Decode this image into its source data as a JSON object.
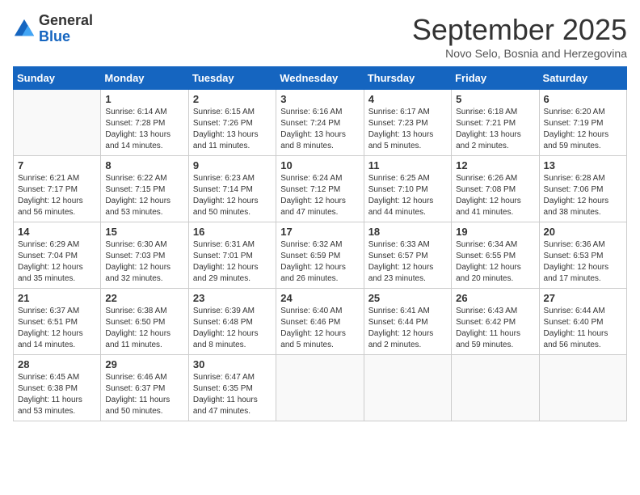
{
  "header": {
    "logo_line1": "General",
    "logo_line2": "Blue",
    "month_title": "September 2025",
    "location": "Novo Selo, Bosnia and Herzegovina"
  },
  "weekdays": [
    "Sunday",
    "Monday",
    "Tuesday",
    "Wednesday",
    "Thursday",
    "Friday",
    "Saturday"
  ],
  "weeks": [
    [
      {
        "day": "",
        "info": ""
      },
      {
        "day": "1",
        "info": "Sunrise: 6:14 AM\nSunset: 7:28 PM\nDaylight: 13 hours\nand 14 minutes."
      },
      {
        "day": "2",
        "info": "Sunrise: 6:15 AM\nSunset: 7:26 PM\nDaylight: 13 hours\nand 11 minutes."
      },
      {
        "day": "3",
        "info": "Sunrise: 6:16 AM\nSunset: 7:24 PM\nDaylight: 13 hours\nand 8 minutes."
      },
      {
        "day": "4",
        "info": "Sunrise: 6:17 AM\nSunset: 7:23 PM\nDaylight: 13 hours\nand 5 minutes."
      },
      {
        "day": "5",
        "info": "Sunrise: 6:18 AM\nSunset: 7:21 PM\nDaylight: 13 hours\nand 2 minutes."
      },
      {
        "day": "6",
        "info": "Sunrise: 6:20 AM\nSunset: 7:19 PM\nDaylight: 12 hours\nand 59 minutes."
      }
    ],
    [
      {
        "day": "7",
        "info": "Sunrise: 6:21 AM\nSunset: 7:17 PM\nDaylight: 12 hours\nand 56 minutes."
      },
      {
        "day": "8",
        "info": "Sunrise: 6:22 AM\nSunset: 7:15 PM\nDaylight: 12 hours\nand 53 minutes."
      },
      {
        "day": "9",
        "info": "Sunrise: 6:23 AM\nSunset: 7:14 PM\nDaylight: 12 hours\nand 50 minutes."
      },
      {
        "day": "10",
        "info": "Sunrise: 6:24 AM\nSunset: 7:12 PM\nDaylight: 12 hours\nand 47 minutes."
      },
      {
        "day": "11",
        "info": "Sunrise: 6:25 AM\nSunset: 7:10 PM\nDaylight: 12 hours\nand 44 minutes."
      },
      {
        "day": "12",
        "info": "Sunrise: 6:26 AM\nSunset: 7:08 PM\nDaylight: 12 hours\nand 41 minutes."
      },
      {
        "day": "13",
        "info": "Sunrise: 6:28 AM\nSunset: 7:06 PM\nDaylight: 12 hours\nand 38 minutes."
      }
    ],
    [
      {
        "day": "14",
        "info": "Sunrise: 6:29 AM\nSunset: 7:04 PM\nDaylight: 12 hours\nand 35 minutes."
      },
      {
        "day": "15",
        "info": "Sunrise: 6:30 AM\nSunset: 7:03 PM\nDaylight: 12 hours\nand 32 minutes."
      },
      {
        "day": "16",
        "info": "Sunrise: 6:31 AM\nSunset: 7:01 PM\nDaylight: 12 hours\nand 29 minutes."
      },
      {
        "day": "17",
        "info": "Sunrise: 6:32 AM\nSunset: 6:59 PM\nDaylight: 12 hours\nand 26 minutes."
      },
      {
        "day": "18",
        "info": "Sunrise: 6:33 AM\nSunset: 6:57 PM\nDaylight: 12 hours\nand 23 minutes."
      },
      {
        "day": "19",
        "info": "Sunrise: 6:34 AM\nSunset: 6:55 PM\nDaylight: 12 hours\nand 20 minutes."
      },
      {
        "day": "20",
        "info": "Sunrise: 6:36 AM\nSunset: 6:53 PM\nDaylight: 12 hours\nand 17 minutes."
      }
    ],
    [
      {
        "day": "21",
        "info": "Sunrise: 6:37 AM\nSunset: 6:51 PM\nDaylight: 12 hours\nand 14 minutes."
      },
      {
        "day": "22",
        "info": "Sunrise: 6:38 AM\nSunset: 6:50 PM\nDaylight: 12 hours\nand 11 minutes."
      },
      {
        "day": "23",
        "info": "Sunrise: 6:39 AM\nSunset: 6:48 PM\nDaylight: 12 hours\nand 8 minutes."
      },
      {
        "day": "24",
        "info": "Sunrise: 6:40 AM\nSunset: 6:46 PM\nDaylight: 12 hours\nand 5 minutes."
      },
      {
        "day": "25",
        "info": "Sunrise: 6:41 AM\nSunset: 6:44 PM\nDaylight: 12 hours\nand 2 minutes."
      },
      {
        "day": "26",
        "info": "Sunrise: 6:43 AM\nSunset: 6:42 PM\nDaylight: 11 hours\nand 59 minutes."
      },
      {
        "day": "27",
        "info": "Sunrise: 6:44 AM\nSunset: 6:40 PM\nDaylight: 11 hours\nand 56 minutes."
      }
    ],
    [
      {
        "day": "28",
        "info": "Sunrise: 6:45 AM\nSunset: 6:38 PM\nDaylight: 11 hours\nand 53 minutes."
      },
      {
        "day": "29",
        "info": "Sunrise: 6:46 AM\nSunset: 6:37 PM\nDaylight: 11 hours\nand 50 minutes."
      },
      {
        "day": "30",
        "info": "Sunrise: 6:47 AM\nSunset: 6:35 PM\nDaylight: 11 hours\nand 47 minutes."
      },
      {
        "day": "",
        "info": ""
      },
      {
        "day": "",
        "info": ""
      },
      {
        "day": "",
        "info": ""
      },
      {
        "day": "",
        "info": ""
      }
    ]
  ]
}
